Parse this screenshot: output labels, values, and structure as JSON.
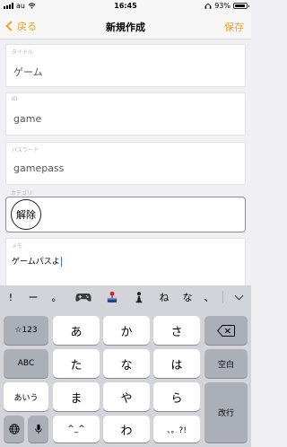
{
  "status": {
    "carrier": "au",
    "time": "16:45",
    "battery": "93%",
    "battery_level": 0.93
  },
  "nav": {
    "back_label": "戻る",
    "title": "新規作成",
    "save_label": "保存"
  },
  "form": {
    "title": {
      "label": "タイトル",
      "value": "ゲーム"
    },
    "id": {
      "label": "ID",
      "value": "game"
    },
    "password": {
      "label": "パスワード",
      "value": "gamepass"
    },
    "category": {
      "label": "カテゴリ",
      "chip_label": "解除"
    },
    "memo": {
      "label": "メモ",
      "value": "ゲームパスよ"
    }
  },
  "predictive": {
    "items": [
      "!",
      "ー",
      "。",
      "controller-emoji",
      "joystick-emoji",
      "chess-pawn-emoji",
      "ね",
      "な",
      "、"
    ]
  },
  "keyboard": {
    "left": [
      "☆123",
      "ABC",
      "あいう"
    ],
    "grid": [
      [
        "あ",
        "か",
        "さ"
      ],
      [
        "た",
        "な",
        "は"
      ],
      [
        "ま",
        "や",
        "ら"
      ],
      [
        "^_^",
        "わ",
        "、。?!"
      ]
    ],
    "bottom_small": [
      "globe-icon",
      "mic-icon"
    ],
    "right": [
      "backspace-icon",
      "空白",
      "改行"
    ]
  }
}
